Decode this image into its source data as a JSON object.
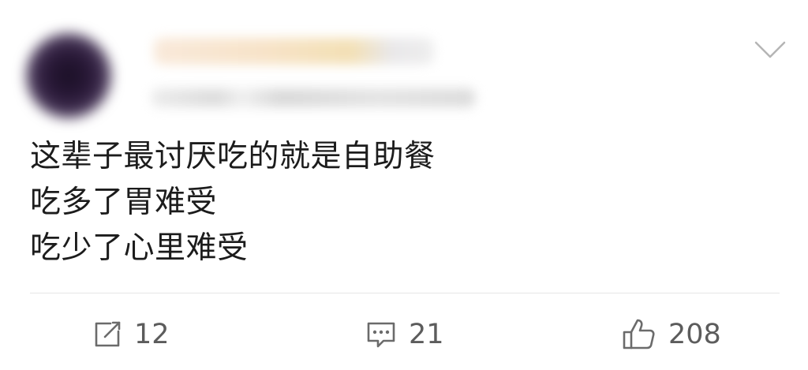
{
  "post": {
    "content_lines": [
      "这辈子最讨厌吃的就是自助餐",
      "吃多了胃难受",
      "吃少了心里难受"
    ]
  },
  "actions": {
    "repost": {
      "icon": "repost-icon",
      "count": "12"
    },
    "comment": {
      "icon": "comment-icon",
      "count": "21"
    },
    "like": {
      "icon": "thumbs-up-icon",
      "count": "208"
    }
  },
  "colors": {
    "text": "#1c1c1c",
    "action_text": "#5c5c5c",
    "icon": "#6b6b6b",
    "divider": "#e6e6e6"
  }
}
